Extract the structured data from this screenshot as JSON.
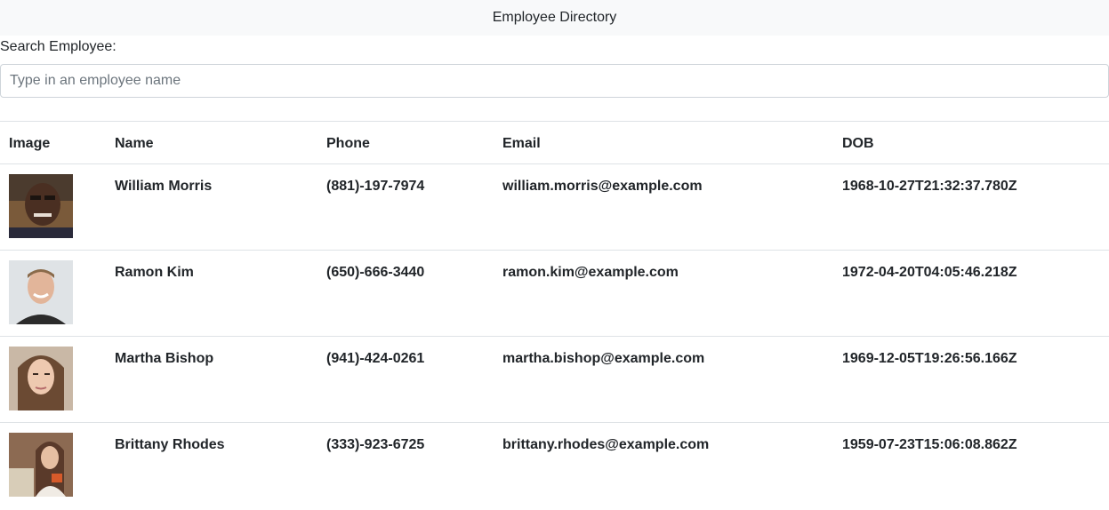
{
  "navbar": {
    "title": "Employee Directory"
  },
  "search": {
    "label": "Search Employee:",
    "placeholder": "Type in an employee name",
    "value": ""
  },
  "table": {
    "headers": [
      "Image",
      "Name",
      "Phone",
      "Email",
      "DOB"
    ],
    "rows": [
      {
        "name": "William Morris",
        "phone": "(881)-197-7974",
        "email": "william.morris@example.com",
        "dob": "1968-10-27T21:32:37.780Z"
      },
      {
        "name": "Ramon Kim",
        "phone": "(650)-666-3440",
        "email": "ramon.kim@example.com",
        "dob": "1972-04-20T04:05:46.218Z"
      },
      {
        "name": "Martha Bishop",
        "phone": "(941)-424-0261",
        "email": "martha.bishop@example.com",
        "dob": "1969-12-05T19:26:56.166Z"
      },
      {
        "name": "Brittany Rhodes",
        "phone": "(333)-923-6725",
        "email": "brittany.rhodes@example.com",
        "dob": "1959-07-23T15:06:08.862Z"
      }
    ]
  }
}
